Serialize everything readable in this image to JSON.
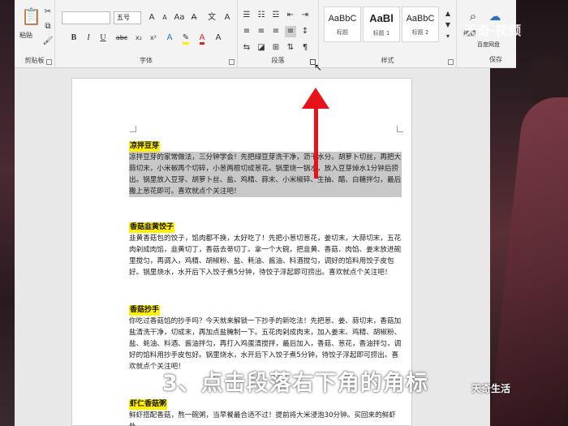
{
  "ribbon": {
    "clipboard": {
      "paste_label": "粘贴",
      "group_label": "剪贴板"
    },
    "font": {
      "font_name_value": "",
      "font_size_value": "五号",
      "group_label": "字体",
      "bold": "B",
      "italic": "I",
      "underline": "U",
      "strike": "abc"
    },
    "paragraph": {
      "group_label": "段落"
    },
    "styles": {
      "group_label": "样式",
      "items": [
        {
          "sample": "AaBbC",
          "name": "标题"
        },
        {
          "sample": "AaBl",
          "name": "标题 1"
        },
        {
          "sample": "AaBbC",
          "name": "标题 2"
        }
      ]
    },
    "editing": {
      "label": "编辑"
    },
    "save": {
      "label": "百度网盘",
      "group_label": "保存"
    },
    "watermark": "天奇·视频"
  },
  "document": {
    "sections": [
      {
        "heading": "凉拌豆芽",
        "body": "凉拌豆芽的家常做法，三分钟学会！先把绿豆芽洗干净，沥干水分。胡萝卜切丝，再把大蒜切末，小米椒再个切碎，小葱两根切成葱花。锅里烧一锅水，放入豆芽焯水1分钟后捞出。锅里放入豆芽、胡萝卜丝、盐、鸡精、蒜末、小米椒碎、生抽、醋、白糖拌匀，最后撒上葱花即可。喜欢就点个关注吧！"
      },
      {
        "heading": "香菇韭黄饺子",
        "body": "韭黄香菇包的饺子，馅肉都不换，太好吃了！先把小葱切葱花，姜切末，大蒜切末，五花肉剁成肉馅，韭黄切丁，香菇去蒂切丁。拿一个大碗，把韭黄、香菇、肉馅、姜末放进碗里搅匀，再调入，鸡精、胡椒粉、盐、耗油、酱油、料酒搅匀，调好的馅料用饺子皮包好。锅里烧水，水开后下入饺子煮5分钟，待饺子浮起即可捞出。喜欢就点个关注吧！"
      },
      {
        "heading": "香菇抄手",
        "body": "你吃过香菇馅的抄手吗？今天就来解锁一下抄手的新吃法！先把葱、姜、蒜切末，香菇加盐清洗干净，切成末，再加点盐腌制一下。五花肉剁成肉末，加入姜末、鸡精、胡椒粉、盐、蚝油、料酒、酱油拌匀，再打入鸡蛋清搅拌，最后加入，香菇、葱花，香油拌匀，调好的馅料用抄手皮包好。锅里烧水，水开后下入饺子煮5分钟，待饺子浮起即可捞出。喜欢就点个关注吧！"
      },
      {
        "heading": "虾仁香菇粥",
        "body": "鲜虾搭配香菇，熬一碗粥，当早餐最合适不过！提前将大米浸泡30分钟。买回来的鲜虾处"
      }
    ]
  },
  "overlay": {
    "caption": "3、点击段落右下角的角标",
    "logo_bottom": "天奇生活"
  },
  "colors": {
    "highlight": "#ffef00",
    "arrow": "#e8121b",
    "selection": "#c8c8c8"
  }
}
